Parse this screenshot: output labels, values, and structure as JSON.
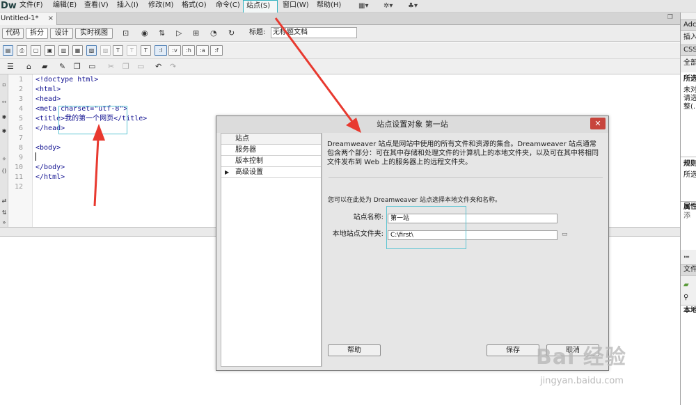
{
  "menubar": {
    "logo": "Dw",
    "items": [
      {
        "label": "文件(F)"
      },
      {
        "label": "编辑(E)"
      },
      {
        "label": "查看(V)"
      },
      {
        "label": "插入(I)"
      },
      {
        "label": "修改(M)"
      },
      {
        "label": "格式(O)"
      },
      {
        "label": "命令(C)"
      },
      {
        "label": "站点(S)"
      },
      {
        "label": "窗口(W)"
      },
      {
        "label": "帮助(H)"
      }
    ],
    "highlighted": "站点(S)"
  },
  "document_tab": {
    "name": "Untitled-1*",
    "close": "×"
  },
  "view_buttons": {
    "code": "代码",
    "split": "拆分",
    "design": "设计",
    "live": "实时视图"
  },
  "title_field": {
    "label": "标题:",
    "value": "无标题文档"
  },
  "insert_row": {
    "buttons": [
      ":l",
      ":v",
      ":h",
      ":a",
      ":f"
    ]
  },
  "code": {
    "line_numbers": [
      "1",
      "2",
      "3",
      "4",
      "5",
      "6",
      "7",
      "8",
      "9",
      "10",
      "11",
      "12"
    ],
    "lines": [
      "<!doctype html>",
      "<html>",
      "<head>",
      "<meta charset=\"utf-8\">",
      "<title>我的第一个网页</title>",
      "</head>",
      "",
      "<body>",
      "",
      "</body>",
      "</html>",
      ""
    ]
  },
  "right_panel": {
    "tab_top": "Adc",
    "insert": "插入",
    "css": "CSS",
    "all": "全部",
    "selected_header": "所选",
    "info_lines": [
      "未对",
      "请选",
      "整(…"
    ],
    "rules_header": "规则",
    "rules_text": "所选",
    "props_header": "属性",
    "props_link": "添",
    "files_tab": "文件",
    "local_header": "本地"
  },
  "dialog": {
    "title": "站点设置对象 第一站",
    "close": "✕",
    "nav": [
      {
        "label": "站点",
        "selected": true
      },
      {
        "label": "服务器"
      },
      {
        "label": "版本控制"
      },
      {
        "label": "高级设置",
        "expandable": true,
        "arrow": "▶"
      }
    ],
    "description": "Dreamweaver 站点是网站中使用的所有文件和资源的集合。Dreamweaver 站点通常包含两个部分：可在其中存储和处理文件的计算机上的本地文件夹，以及可在其中将相同文件发布到 Web 上的服务器上的远程文件夹。",
    "hint": "您可以在此处为 Dreamweaver 站点选择本地文件夹和名称。",
    "site_name": {
      "label": "站点名称:",
      "value": "第一站"
    },
    "local_folder": {
      "label": "本地站点文件夹:",
      "value": "C:\\first\\"
    },
    "buttons": {
      "help": "帮助",
      "save": "保存",
      "cancel": "取消"
    }
  },
  "watermark": {
    "main": "Bai 经验",
    "sub": "jingyan.baidu.com"
  },
  "colors": {
    "highlight_box": "#5cc5d3",
    "arrow": "#e8392f",
    "dialog_close": "#c7443c"
  }
}
